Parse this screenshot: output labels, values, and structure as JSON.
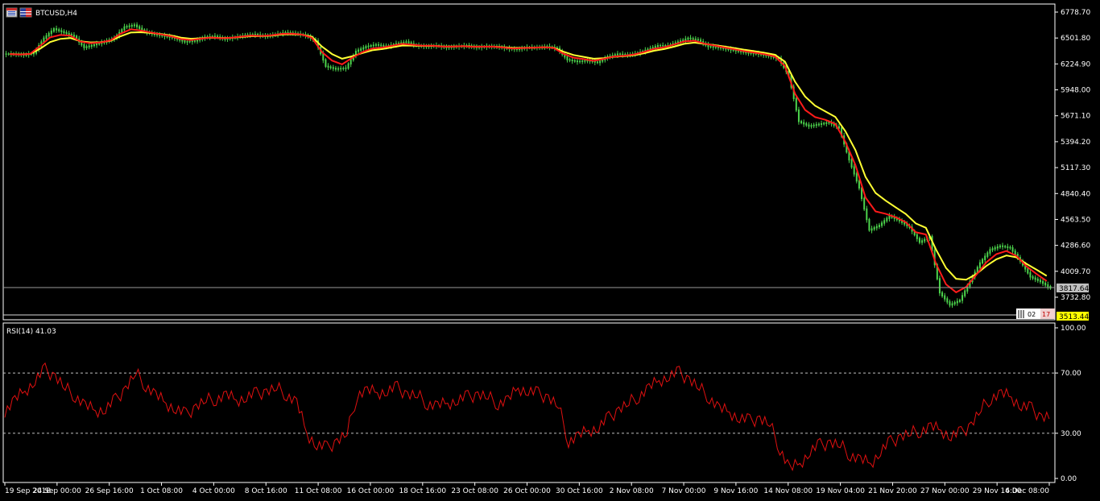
{
  "header": {
    "symbol_label": "BTCUSD,H4",
    "rsi_label": "RSI(14) 41.03"
  },
  "colors": {
    "background": "#000000",
    "frame": "#ffffff",
    "candle_up": "#4cd44c",
    "candle_down": "#4cd44c",
    "ma_fast": "#ff1a1a",
    "ma_slow": "#ffff33",
    "rsi_line": "#e01010",
    "level_line": "#c0c0c0",
    "bid_tag_bg": "#c0c0c0",
    "low_tag_bg": "#ffff00"
  },
  "price_tags": {
    "bid": "3817.64",
    "low": "3513.44"
  },
  "mini_buttons": [
    "02",
    "17"
  ],
  "chart_data": {
    "type": "candlestick",
    "timeframe": "H4",
    "price_axis": {
      "ticks": [
        6778.7,
        6501.8,
        6224.9,
        5948.0,
        5671.1,
        5394.2,
        5117.3,
        4840.4,
        4563.5,
        4286.6,
        4009.7,
        3732.8
      ],
      "ylim": [
        3513.44,
        6778.7
      ]
    },
    "x_tick_labels": [
      "19 Sep 2018",
      "24 Sep 00:00",
      "26 Sep 16:00",
      "1 Oct 08:00",
      "4 Oct 00:00",
      "8 Oct 16:00",
      "11 Oct 08:00",
      "16 Oct 00:00",
      "18 Oct 16:00",
      "23 Oct 08:00",
      "26 Oct 00:00",
      "30 Oct 16:00",
      "2 Nov 08:00",
      "7 Nov 00:00",
      "9 Nov 16:00",
      "14 Nov 08:00",
      "19 Nov 04:00",
      "21 Nov 20:00",
      "27 Nov 00:00",
      "29 Nov 16:00",
      "4 Dec 08:00"
    ],
    "series": [
      {
        "type": "close",
        "values": [
          6330,
          6320,
          6340,
          6500,
          6600,
          6560,
          6520,
          6400,
          6430,
          6460,
          6500,
          6620,
          6640,
          6570,
          6540,
          6520,
          6500,
          6460,
          6470,
          6510,
          6520,
          6490,
          6510,
          6530,
          6540,
          6520,
          6540,
          6560,
          6550,
          6530,
          6470,
          6200,
          6170,
          6180,
          6360,
          6410,
          6430,
          6410,
          6440,
          6460,
          6420,
          6410,
          6420,
          6400,
          6410,
          6420,
          6400,
          6410,
          6410,
          6390,
          6380,
          6400,
          6400,
          6410,
          6390,
          6270,
          6250,
          6260,
          6240,
          6300,
          6330,
          6320,
          6340,
          6380,
          6420,
          6420,
          6460,
          6500,
          6480,
          6410,
          6400,
          6380,
          6360,
          6340,
          6330,
          6310,
          6280,
          6100,
          5610,
          5560,
          5580,
          5600,
          5540,
          5200,
          4900,
          4450,
          4500,
          4600,
          4550,
          4480,
          4320,
          4380,
          3780,
          3650,
          3700,
          3900,
          4100,
          4240,
          4280,
          4260,
          4120,
          3950,
          3900,
          3830
        ]
      },
      {
        "type": "ma_fast",
        "color": "#ff1a1a"
      },
      {
        "type": "ma_slow",
        "color": "#ffff33"
      }
    ],
    "rsi": {
      "period": 14,
      "current": 41.03,
      "ticks": [
        100.0,
        70.0,
        30.0,
        0.0
      ],
      "levels": [
        70,
        30
      ],
      "ylim": [
        0,
        100
      ],
      "values": [
        45,
        52,
        58,
        65,
        72,
        68,
        60,
        55,
        48,
        45,
        46,
        52,
        60,
        70,
        62,
        55,
        50,
        46,
        42,
        48,
        52,
        53,
        55,
        52,
        54,
        56,
        58,
        60,
        56,
        50,
        30,
        22,
        20,
        25,
        30,
        56,
        58,
        57,
        58,
        60,
        56,
        55,
        50,
        48,
        50,
        52,
        54,
        56,
        54,
        50,
        52,
        60,
        58,
        56,
        54,
        48,
        25,
        28,
        32,
        34,
        40,
        46,
        50,
        55,
        60,
        65,
        68,
        70,
        66,
        60,
        54,
        46,
        44,
        40,
        38,
        40,
        36,
        20,
        6,
        10,
        18,
        22,
        24,
        22,
        16,
        12,
        10,
        18,
        24,
        28,
        30,
        32,
        34,
        32,
        28,
        30,
        36,
        46,
        54,
        56,
        54,
        48,
        46,
        41
      ]
    }
  }
}
